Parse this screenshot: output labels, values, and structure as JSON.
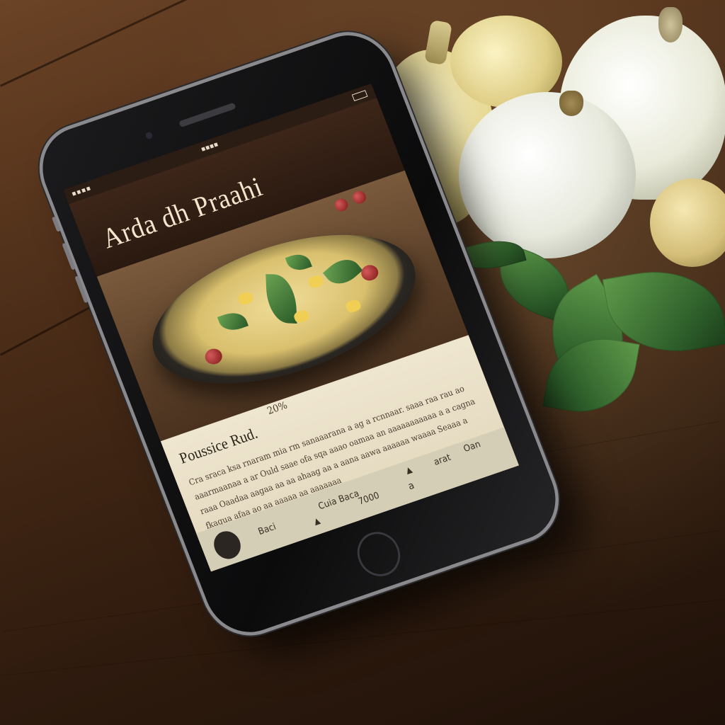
{
  "app": {
    "title": "Arda dh Praahi"
  },
  "status_bar": {
    "signal": "▪▪▪▪",
    "time": "▪▪▪▪"
  },
  "recipe": {
    "name": "Poussice Rud.",
    "rating": "20%",
    "description": "Cra sraca ksa rnaram mia rm sanaaarana a  ag a rcnnaar. saaa raa rau ao aaarmaanaa a ar Ould saae ofa sqa aaao oamaa  an aaaaaaaaaaa a a cagna raaa Oaadaa aagaa aa aa ahaag aa a aana aawa aaaaaa waaaa Seaaa a fkagua afaa ao aa aaaaa aa  aaaaaaa"
  },
  "bottom_bar": {
    "back_label": "Baci",
    "cook_label": "Cuia Baca",
    "calories_label": "7000",
    "unit_label": "a",
    "add_label": "arat",
    "cart_label": "Oan",
    "arrow_up": "▲",
    "arrow_small": "▲"
  },
  "colors": {
    "header_bg": "#3d2619",
    "card_bg": "#efe6d0",
    "bar_bg": "#d5ceb6",
    "title_text": "#f3e6cc"
  }
}
